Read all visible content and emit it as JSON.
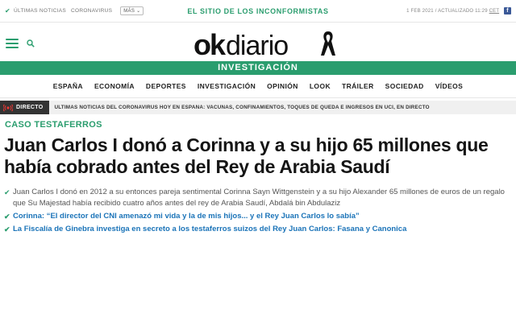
{
  "topbar": {
    "latest_news": "ÚLTIMAS NOTICIAS",
    "coronavirus": "CORONAVIRUS",
    "more_label": "MÁS",
    "slogan": "EL SITIO DE LOS INCONFORMISTAS",
    "date": "1 FEB 2021 / ACTUALIZADO 11:29",
    "timezone": "CET",
    "fb_letter": "f"
  },
  "logo": {
    "ok": "ok",
    "diario": "diario"
  },
  "section": "INVESTIGACIÓN",
  "nav": [
    "ESPAÑA",
    "ECONOMÍA",
    "DEPORTES",
    "INVESTIGACIÓN",
    "OPINIÓN",
    "LOOK",
    "TRÁILER",
    "SOCIEDAD",
    "VÍDEOS"
  ],
  "ticker": {
    "label": "DIRECTO",
    "text": "ÚLTIMAS NOTICIAS DEL CORONAVIRUS HOY EN ESPAÑA: VACUNAS, CONFINAMIENTOS, TOQUES DE QUEDA E INGRESOS EN UCI, EN DIRECTO"
  },
  "article": {
    "kicker": "CASO TESTAFERROS",
    "headline": "Juan Carlos I donó a Corinna y a su hijo 65 millones que había cobrado antes del Rey de Arabia Saudí",
    "summary": "Juan Carlos I donó en 2012 a su entonces pareja sentimental Corinna Sayn Wittgenstein y a su hijo Alexander 65 millones de euros de un regalo que Su Majestad había recibido cuatro años antes del rey de Arabia Saudí, Abdalá bin Abdulaziz",
    "related": [
      "Corinna: “El director del CNI amenazó mi vida y la de mis hijos... y el Rey Juan Carlos lo sabía”",
      "La Fiscalía de Ginebra investiga en secreto a los testaferros suizos del Rey Juan Carlos: Fasana y Canonica"
    ]
  },
  "colors": {
    "brand_green": "#2a9d6e",
    "link_blue": "#1a73b8"
  },
  "icons": [
    "check-icon",
    "facebook-icon",
    "menu-icon",
    "search-icon",
    "mourning-ribbon-icon",
    "live-broadcast-icon"
  ]
}
